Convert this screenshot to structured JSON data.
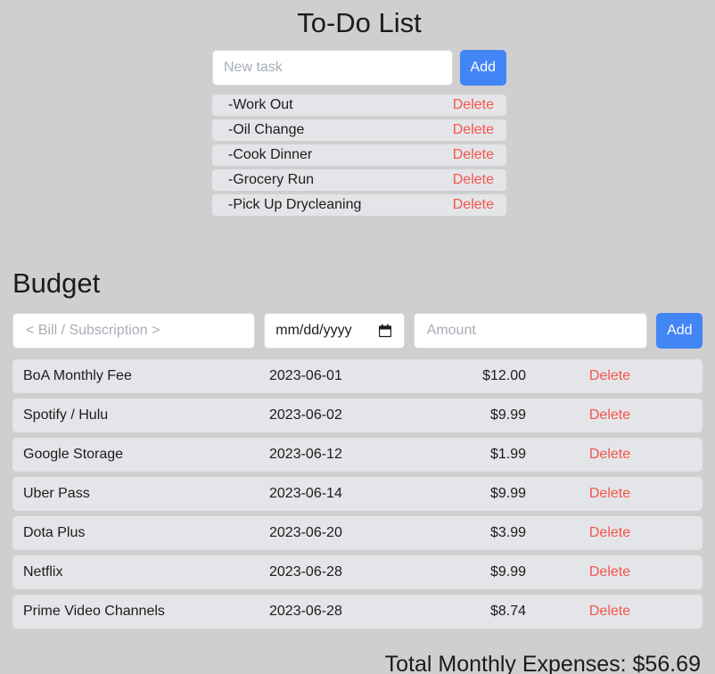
{
  "theme": {
    "page_background": "#cfcfcf",
    "row_background": "#e4e5e8",
    "accent_blue": "#4285f4",
    "delete_red": "#f4554c",
    "text_color": "#1c1c1c",
    "placeholder_color": "#a7aeb6"
  },
  "todo": {
    "title": "To-Do List",
    "input_placeholder": "New task",
    "input_value": "",
    "add_label": "Add",
    "delete_label": "Delete",
    "items": [
      {
        "label": "-Work Out"
      },
      {
        "label": "-Oil Change"
      },
      {
        "label": "-Cook Dinner"
      },
      {
        "label": "-Grocery Run"
      },
      {
        "label": "-Pick Up Drycleaning"
      }
    ]
  },
  "budget": {
    "title": "Budget",
    "bill_placeholder": "< Bill / Subscription >",
    "bill_value": "",
    "date_placeholder": "mm/dd/yyyy",
    "date_value": "",
    "amount_placeholder": "Amount",
    "amount_value": "",
    "add_label": "Add",
    "delete_label": "Delete",
    "rows": [
      {
        "name": "BoA Monthly Fee",
        "date": "2023-06-01",
        "amount": "$12.00"
      },
      {
        "name": "Spotify / Hulu",
        "date": "2023-06-02",
        "amount": "$9.99"
      },
      {
        "name": "Google Storage",
        "date": "2023-06-12",
        "amount": "$1.99"
      },
      {
        "name": "Uber Pass",
        "date": "2023-06-14",
        "amount": "$9.99"
      },
      {
        "name": "Dota Plus",
        "date": "2023-06-20",
        "amount": "$3.99"
      },
      {
        "name": "Netflix",
        "date": "2023-06-28",
        "amount": "$9.99"
      },
      {
        "name": "Prime Video Channels",
        "date": "2023-06-28",
        "amount": "$8.74"
      }
    ],
    "total_text": "Total Monthly Expenses: $56.69"
  }
}
